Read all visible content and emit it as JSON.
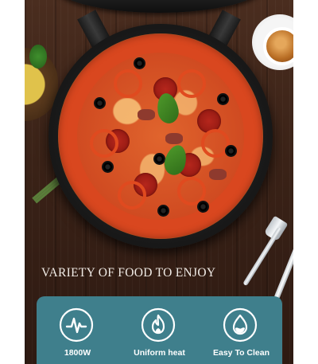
{
  "tagline": "VARIETY OF FOOD TO ENJOY",
  "features": [
    {
      "label": "1800W",
      "icon": "power-icon"
    },
    {
      "label": "Uniform heat",
      "icon": "flame-icon"
    },
    {
      "label": "Easy To Clean",
      "icon": "water-drop-icon"
    }
  ],
  "colors": {
    "panel": "#3f7f8c",
    "text": "#ffffff",
    "tagline": "#f1ece6"
  }
}
